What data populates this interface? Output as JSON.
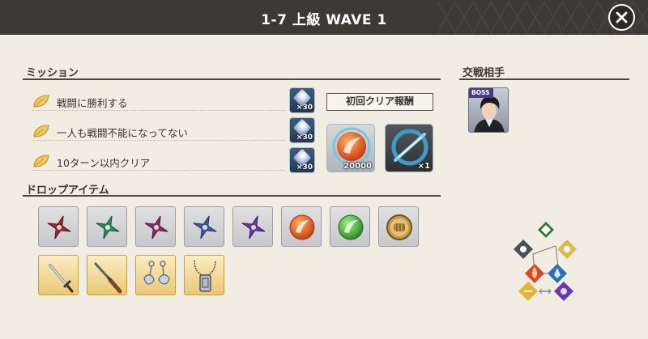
{
  "header": {
    "title": "1-7 上級 WAVE 1"
  },
  "missions": {
    "title": "ミッション",
    "items": [
      {
        "text": "戦闘に勝利する",
        "reward_qty": "×30"
      },
      {
        "text": "一人も戦闘不能になってない",
        "reward_qty": "×30"
      },
      {
        "text": "10ターン以内クリア",
        "reward_qty": "×30"
      }
    ]
  },
  "first_clear": {
    "label": "初回クリア報酬",
    "rewards": [
      {
        "icon": "orange-orb-icon",
        "qty": "20000"
      },
      {
        "icon": "blue-slash-icon",
        "qty": "×1"
      }
    ]
  },
  "drops": {
    "title": "ドロップアイテム",
    "items": [
      {
        "icon": "red-shuriken-icon",
        "color": "#9a2a34"
      },
      {
        "icon": "green-shuriken-icon",
        "color": "#2f8a5b"
      },
      {
        "icon": "magenta-shuriken-icon",
        "color": "#8a2a6a"
      },
      {
        "icon": "blue-shuriken-icon",
        "color": "#3f5c9a"
      },
      {
        "icon": "purple-shuriken-icon",
        "color": "#6a3aa0"
      },
      {
        "icon": "orange-orb-icon",
        "color": "#e2631f"
      },
      {
        "icon": "green-orb-icon",
        "color": "#3faa3a"
      },
      {
        "icon": "fist-coin-icon",
        "color": "#b58a3a"
      },
      {
        "icon": "sword-icon"
      },
      {
        "icon": "rifle-icon"
      },
      {
        "icon": "earrings-icon"
      },
      {
        "icon": "dog-tag-necklace-icon"
      }
    ]
  },
  "opponent": {
    "title": "交戦相手",
    "badge": "BOSS",
    "icon": "boss-portrait-icon"
  },
  "element_chart": {
    "icon": "element-affinity-chart-icon",
    "elements": [
      "light-icon",
      "wind-icon",
      "fire-icon",
      "water-icon",
      "earth-icon",
      "dark-icon"
    ]
  }
}
